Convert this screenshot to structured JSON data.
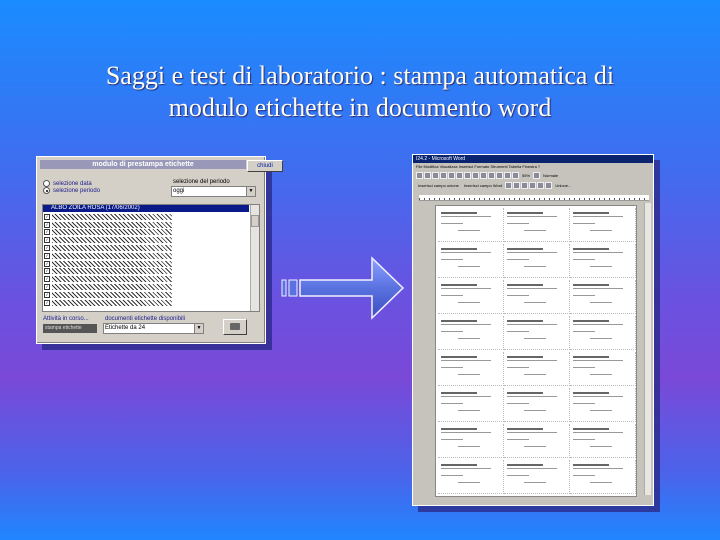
{
  "slide": {
    "title_line1": "Saggi e test di laboratorio : stampa automatica di",
    "title_line2": "modulo etichette in documento word"
  },
  "dialog": {
    "header": "modulo di prestampa etichette",
    "close_button": "chiudi",
    "radio_date": "selezione data",
    "radio_period": "selezione periodo",
    "period_label": "selezione del periodo",
    "period_value": "oggi",
    "list_selected": "ALBO ZOILA ROSA  (17/06/2002)",
    "list_row_count": 12,
    "activity_label": "Attività in corso...",
    "progress_text": "stampa etichette",
    "docs_label": "documenti etichette disponibili",
    "docs_value": "Etichette da 24"
  },
  "word": {
    "title": "I24.2 - Microsoft Word",
    "menu": "File  Modifica  Visualizza  Inserisci  Formato  Strumenti  Tabella  Finestra  ?",
    "zoom": "55%",
    "style": "Normale",
    "toolbar2_a": "Inserisci campo unione",
    "toolbar2_b": "Inserisci campo Word",
    "toolbar2_c": "Unione..."
  },
  "colors": {
    "dialog_bg": "#d4d0c8",
    "selected_row": "#0a1a88",
    "word_title": "#0a2470",
    "arrow_fill": "#5a72e0"
  }
}
